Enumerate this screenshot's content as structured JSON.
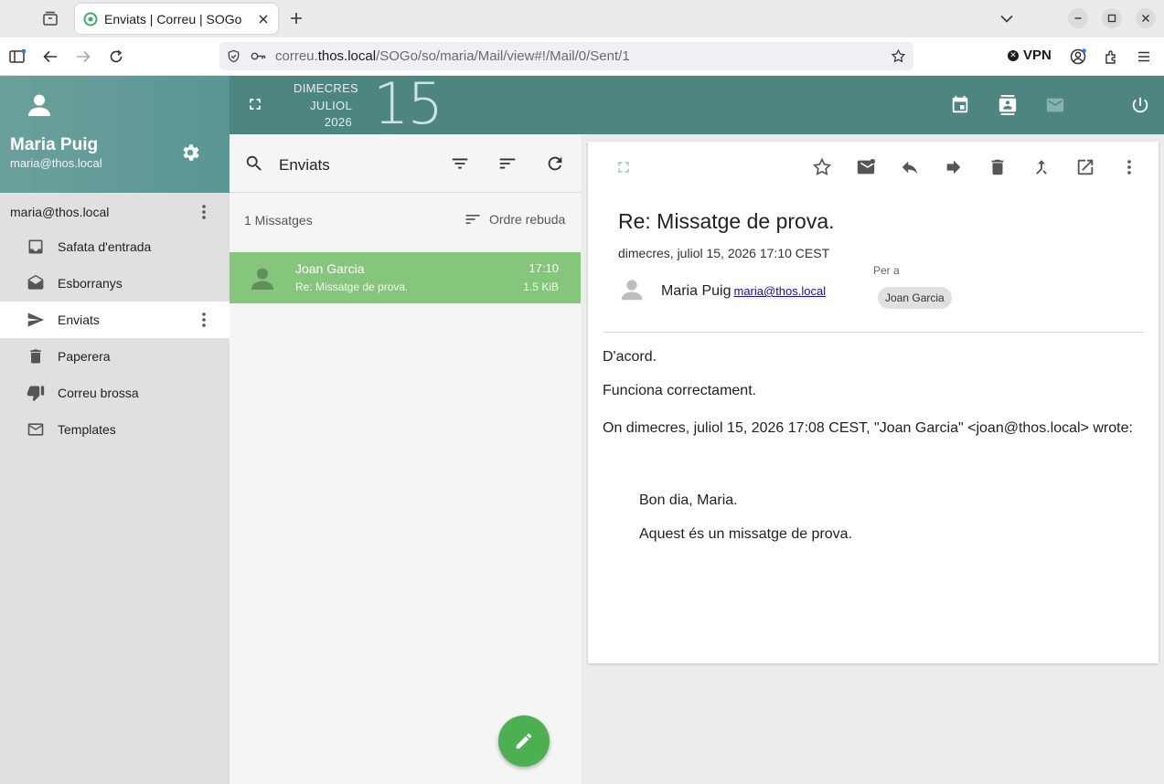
{
  "browser": {
    "tab_title": "Enviats | Correu | SOGo",
    "url_prefix": "correu.",
    "url_host": "thos.local",
    "url_path": "/SOGo/so/maria/Mail/view#!/Mail/0/Sent/1",
    "vpn_label": "VPN"
  },
  "user": {
    "name": "Maria Puig",
    "email": "maria@thos.local",
    "account": "maria@thos.local"
  },
  "folders": [
    {
      "label": "Safata d'entrada",
      "icon": "inbox-icon"
    },
    {
      "label": "Esborranys",
      "icon": "drafts-icon"
    },
    {
      "label": "Enviats",
      "icon": "send-icon",
      "active": true
    },
    {
      "label": "Paperera",
      "icon": "trash-icon"
    },
    {
      "label": "Correu brossa",
      "icon": "thumb-down-icon"
    },
    {
      "label": "Templates",
      "icon": "mail-outline-icon"
    }
  ],
  "date": {
    "weekday": "DIMECRES",
    "month": "JULIOL",
    "year": "2026",
    "day": "15"
  },
  "list": {
    "folder_title": "Enviats",
    "count": "1 Missatges",
    "sort_label": "Ordre rebuda",
    "messages": [
      {
        "from": "Joan Garcia",
        "subject": "Re: Missatge de prova.",
        "time": "17:10",
        "size": "1.5 KiB"
      }
    ]
  },
  "message": {
    "subject": "Re: Missatge de prova.",
    "date": "dimecres, juliol 15, 2026 17:10 CEST",
    "sender_name": "Maria Puig",
    "sender_email": "maria@thos.local",
    "to_label": "Per a",
    "to_chip": "Joan Garcia",
    "body": [
      "D'acord.",
      "Funciona correctament.",
      "On dimecres, juliol 15, 2026 17:08 CEST, \"Joan Garcia\" <joan@thos.local> wrote:"
    ],
    "quoted": [
      "Bon dia, Maria.",
      "Aquest és un missatge de prova."
    ]
  },
  "colors": {
    "header": "#5f9b97",
    "topband": "#4d8581",
    "selected_row": "#86c67c",
    "fab": "#4caf50"
  }
}
